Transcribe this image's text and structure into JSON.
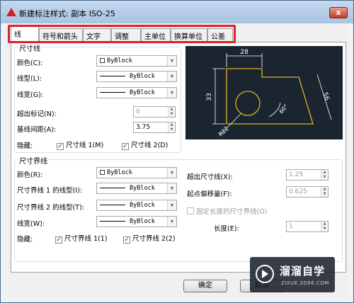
{
  "title": "新建标注样式: 副本 ISO-25",
  "close_label": "x",
  "tabs": [
    {
      "label": "线",
      "active": true
    },
    {
      "label": "符号和箭头"
    },
    {
      "label": "文字"
    },
    {
      "label": "调整"
    },
    {
      "label": "主单位"
    },
    {
      "label": "换算单位"
    },
    {
      "label": "公差"
    }
  ],
  "dimlines": {
    "group_label": "尺寸线",
    "color_label": "颜色(C):",
    "color_value": "ByBlock",
    "linetype_label": "线型(L):",
    "linetype_value": "ByBlock",
    "lineweight_label": "线宽(G):",
    "lineweight_value": "ByBlock",
    "extend_ticks_label": "超出标记(N):",
    "extend_ticks_value": "0",
    "baseline_label": "基线间距(A):",
    "baseline_value": "3.75",
    "suppress_label": "隐藏:",
    "suppress1_label": "尺寸线 1(M)",
    "suppress2_label": "尺寸线 2(D)"
  },
  "extlines": {
    "group_label": "尺寸界线",
    "color_label": "颜色(R):",
    "color_value": "ByBlock",
    "linetype1_label": "尺寸界线 1 的线型(I):",
    "linetype1_value": "ByBlock",
    "linetype2_label": "尺寸界线 2 的线型(T):",
    "linetype2_value": "ByBlock",
    "lineweight_label": "线宽(W):",
    "lineweight_value": "ByBlock",
    "suppress_label": "隐藏:",
    "suppress1_label": "尺寸界线 1(1)",
    "suppress2_label": "尺寸界线 2(2)",
    "extend_label": "超出尺寸线(X):",
    "extend_value": "1.25",
    "offset_label": "起点偏移量(F):",
    "offset_value": "0.625",
    "fixed_label": "固定长度的尺寸界线(O)",
    "length_label": "长度(E):",
    "length_value": "1"
  },
  "preview": {
    "dim_top": "28",
    "dim_left": "33",
    "dim_right": "56",
    "dim_angle": "60°",
    "dim_radius": "R22"
  },
  "buttons": {
    "ok": "确定",
    "cancel": "取消"
  },
  "watermark": {
    "text": "溜溜自学",
    "url": "ZIXUE.3D66.COM"
  },
  "colors": {
    "highlight_box": "#e0202a",
    "preview_bg": "#1b2530",
    "geometry": "#e0b020"
  }
}
